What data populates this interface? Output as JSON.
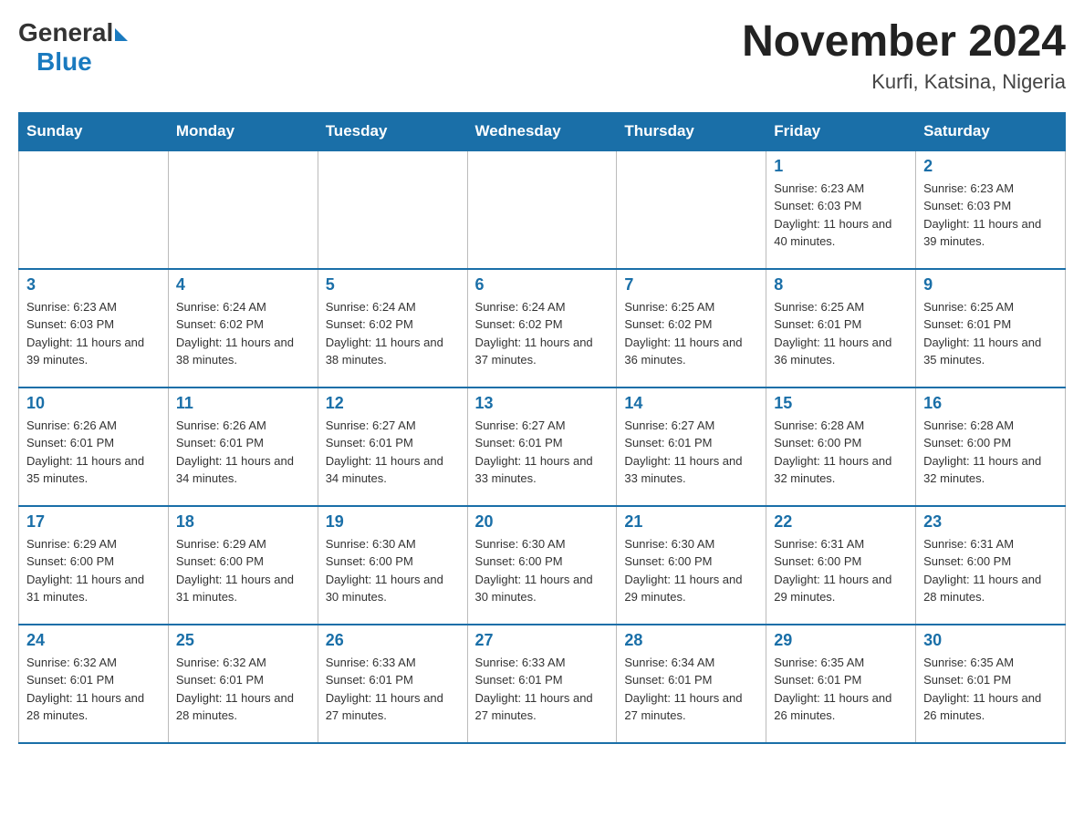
{
  "header": {
    "logo": {
      "general": "General",
      "blue": "Blue",
      "arrow": true
    },
    "month_title": "November 2024",
    "location": "Kurfi, Katsina, Nigeria"
  },
  "calendar": {
    "days_of_week": [
      "Sunday",
      "Monday",
      "Tuesday",
      "Wednesday",
      "Thursday",
      "Friday",
      "Saturday"
    ],
    "weeks": [
      [
        {
          "day": "",
          "info": ""
        },
        {
          "day": "",
          "info": ""
        },
        {
          "day": "",
          "info": ""
        },
        {
          "day": "",
          "info": ""
        },
        {
          "day": "",
          "info": ""
        },
        {
          "day": "1",
          "info": "Sunrise: 6:23 AM\nSunset: 6:03 PM\nDaylight: 11 hours and 40 minutes."
        },
        {
          "day": "2",
          "info": "Sunrise: 6:23 AM\nSunset: 6:03 PM\nDaylight: 11 hours and 39 minutes."
        }
      ],
      [
        {
          "day": "3",
          "info": "Sunrise: 6:23 AM\nSunset: 6:03 PM\nDaylight: 11 hours and 39 minutes."
        },
        {
          "day": "4",
          "info": "Sunrise: 6:24 AM\nSunset: 6:02 PM\nDaylight: 11 hours and 38 minutes."
        },
        {
          "day": "5",
          "info": "Sunrise: 6:24 AM\nSunset: 6:02 PM\nDaylight: 11 hours and 38 minutes."
        },
        {
          "day": "6",
          "info": "Sunrise: 6:24 AM\nSunset: 6:02 PM\nDaylight: 11 hours and 37 minutes."
        },
        {
          "day": "7",
          "info": "Sunrise: 6:25 AM\nSunset: 6:02 PM\nDaylight: 11 hours and 36 minutes."
        },
        {
          "day": "8",
          "info": "Sunrise: 6:25 AM\nSunset: 6:01 PM\nDaylight: 11 hours and 36 minutes."
        },
        {
          "day": "9",
          "info": "Sunrise: 6:25 AM\nSunset: 6:01 PM\nDaylight: 11 hours and 35 minutes."
        }
      ],
      [
        {
          "day": "10",
          "info": "Sunrise: 6:26 AM\nSunset: 6:01 PM\nDaylight: 11 hours and 35 minutes."
        },
        {
          "day": "11",
          "info": "Sunrise: 6:26 AM\nSunset: 6:01 PM\nDaylight: 11 hours and 34 minutes."
        },
        {
          "day": "12",
          "info": "Sunrise: 6:27 AM\nSunset: 6:01 PM\nDaylight: 11 hours and 34 minutes."
        },
        {
          "day": "13",
          "info": "Sunrise: 6:27 AM\nSunset: 6:01 PM\nDaylight: 11 hours and 33 minutes."
        },
        {
          "day": "14",
          "info": "Sunrise: 6:27 AM\nSunset: 6:01 PM\nDaylight: 11 hours and 33 minutes."
        },
        {
          "day": "15",
          "info": "Sunrise: 6:28 AM\nSunset: 6:00 PM\nDaylight: 11 hours and 32 minutes."
        },
        {
          "day": "16",
          "info": "Sunrise: 6:28 AM\nSunset: 6:00 PM\nDaylight: 11 hours and 32 minutes."
        }
      ],
      [
        {
          "day": "17",
          "info": "Sunrise: 6:29 AM\nSunset: 6:00 PM\nDaylight: 11 hours and 31 minutes."
        },
        {
          "day": "18",
          "info": "Sunrise: 6:29 AM\nSunset: 6:00 PM\nDaylight: 11 hours and 31 minutes."
        },
        {
          "day": "19",
          "info": "Sunrise: 6:30 AM\nSunset: 6:00 PM\nDaylight: 11 hours and 30 minutes."
        },
        {
          "day": "20",
          "info": "Sunrise: 6:30 AM\nSunset: 6:00 PM\nDaylight: 11 hours and 30 minutes."
        },
        {
          "day": "21",
          "info": "Sunrise: 6:30 AM\nSunset: 6:00 PM\nDaylight: 11 hours and 29 minutes."
        },
        {
          "day": "22",
          "info": "Sunrise: 6:31 AM\nSunset: 6:00 PM\nDaylight: 11 hours and 29 minutes."
        },
        {
          "day": "23",
          "info": "Sunrise: 6:31 AM\nSunset: 6:00 PM\nDaylight: 11 hours and 28 minutes."
        }
      ],
      [
        {
          "day": "24",
          "info": "Sunrise: 6:32 AM\nSunset: 6:01 PM\nDaylight: 11 hours and 28 minutes."
        },
        {
          "day": "25",
          "info": "Sunrise: 6:32 AM\nSunset: 6:01 PM\nDaylight: 11 hours and 28 minutes."
        },
        {
          "day": "26",
          "info": "Sunrise: 6:33 AM\nSunset: 6:01 PM\nDaylight: 11 hours and 27 minutes."
        },
        {
          "day": "27",
          "info": "Sunrise: 6:33 AM\nSunset: 6:01 PM\nDaylight: 11 hours and 27 minutes."
        },
        {
          "day": "28",
          "info": "Sunrise: 6:34 AM\nSunset: 6:01 PM\nDaylight: 11 hours and 27 minutes."
        },
        {
          "day": "29",
          "info": "Sunrise: 6:35 AM\nSunset: 6:01 PM\nDaylight: 11 hours and 26 minutes."
        },
        {
          "day": "30",
          "info": "Sunrise: 6:35 AM\nSunset: 6:01 PM\nDaylight: 11 hours and 26 minutes."
        }
      ]
    ]
  }
}
